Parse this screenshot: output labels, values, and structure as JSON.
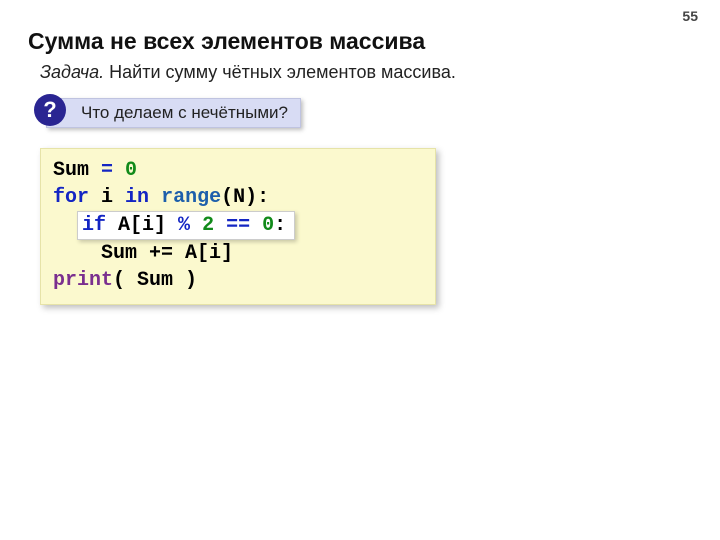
{
  "page_number": "55",
  "title": "Сумма не всех элементов массива",
  "task_label": "Задача.",
  "task_text": " Найти сумму чётных элементов массива.",
  "callout_text": "Что делаем с нечётными?",
  "qmark": "?",
  "code": {
    "l1a": "Sum ",
    "l1eq": "=",
    "l1sp": " ",
    "l1b": "0",
    "l2a": "for",
    "l2b": " i ",
    "l2c": "in",
    "l2d": " ",
    "l2e": "range",
    "l2f": "(N):",
    "l3pad": "  ",
    "l3a": "if",
    "l3b": " A[i] ",
    "l3c": "%",
    "l3d": " ",
    "l3e": "2",
    "l3f": " ",
    "l3g": "==",
    "l3h": " ",
    "l3i": "0",
    "l3j": ":",
    "l4": "    Sum += A[i]",
    "l5a": "print",
    "l5b": "( Sum )"
  }
}
